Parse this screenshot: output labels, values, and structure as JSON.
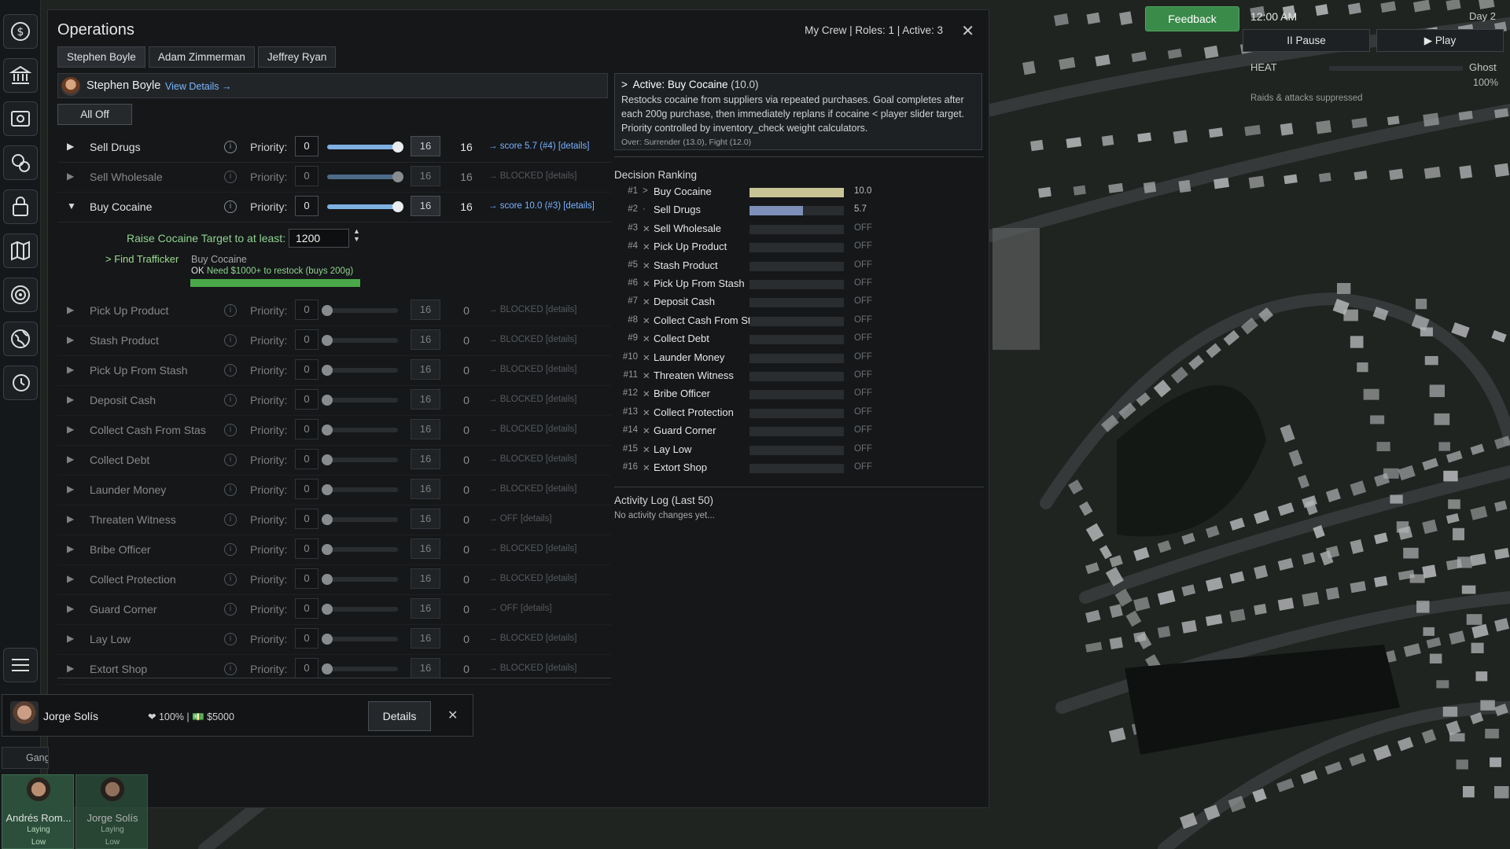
{
  "panel": {
    "title": "Operations",
    "crew_summary": "My Crew | Roles: 1 | Active: 3",
    "close_glyph": "✕",
    "tabs": [
      "Stephen Boyle",
      "Adam Zimmerman",
      "Jeffrey Ryan"
    ],
    "active_tab": 0,
    "member_name": "Stephen Boyle",
    "view_details": "View Details →",
    "all_off": "All Off"
  },
  "tasks": [
    {
      "name": "Sell Drugs",
      "expanded": false,
      "priority_label": "Priority:",
      "min": "0",
      "max": "16",
      "value": "16",
      "score": "→ score 5.7 (#4) [details]",
      "enabled": true,
      "level": 1.0
    },
    {
      "name": "Sell Wholesale",
      "expanded": false,
      "priority_label": "Priority:",
      "min": "0",
      "max": "16",
      "value": "16",
      "score": "→ BLOCKED [details]",
      "enabled": false,
      "level": 1.0
    },
    {
      "name": "Buy Cocaine",
      "expanded": true,
      "priority_label": "Priority:",
      "min": "0",
      "max": "16",
      "value": "16",
      "score": "→ score 10.0 (#3) [details]",
      "enabled": true,
      "level": 1.0
    },
    {
      "name": "Pick Up Product",
      "expanded": false,
      "priority_label": "Priority:",
      "min": "0",
      "max": "16",
      "value": "0",
      "score": "→ BLOCKED [details]",
      "enabled": false,
      "level": 0
    },
    {
      "name": "Stash Product",
      "expanded": false,
      "priority_label": "Priority:",
      "min": "0",
      "max": "16",
      "value": "0",
      "score": "→ BLOCKED [details]",
      "enabled": false,
      "level": 0
    },
    {
      "name": "Pick Up From Stash",
      "expanded": false,
      "priority_label": "Priority:",
      "min": "0",
      "max": "16",
      "value": "0",
      "score": "→ BLOCKED [details]",
      "enabled": false,
      "level": 0
    },
    {
      "name": "Deposit Cash",
      "expanded": false,
      "priority_label": "Priority:",
      "min": "0",
      "max": "16",
      "value": "0",
      "score": "→ BLOCKED [details]",
      "enabled": false,
      "level": 0
    },
    {
      "name": "Collect Cash From Stas",
      "expanded": false,
      "priority_label": "Priority:",
      "min": "0",
      "max": "16",
      "value": "0",
      "score": "→ BLOCKED [details]",
      "enabled": false,
      "level": 0
    },
    {
      "name": "Collect Debt",
      "expanded": false,
      "priority_label": "Priority:",
      "min": "0",
      "max": "16",
      "value": "0",
      "score": "→ BLOCKED [details]",
      "enabled": false,
      "level": 0
    },
    {
      "name": "Launder Money",
      "expanded": false,
      "priority_label": "Priority:",
      "min": "0",
      "max": "16",
      "value": "0",
      "score": "→ BLOCKED [details]",
      "enabled": false,
      "level": 0
    },
    {
      "name": "Threaten Witness",
      "expanded": false,
      "priority_label": "Priority:",
      "min": "0",
      "max": "16",
      "value": "0",
      "score": "→ OFF [details]",
      "enabled": false,
      "level": 0
    },
    {
      "name": "Bribe Officer",
      "expanded": false,
      "priority_label": "Priority:",
      "min": "0",
      "max": "16",
      "value": "0",
      "score": "→ BLOCKED [details]",
      "enabled": false,
      "level": 0
    },
    {
      "name": "Collect Protection",
      "expanded": false,
      "priority_label": "Priority:",
      "min": "0",
      "max": "16",
      "value": "0",
      "score": "→ BLOCKED [details]",
      "enabled": false,
      "level": 0
    },
    {
      "name": "Guard Corner",
      "expanded": false,
      "priority_label": "Priority:",
      "min": "0",
      "max": "16",
      "value": "0",
      "score": "→ OFF [details]",
      "enabled": false,
      "level": 0
    },
    {
      "name": "Lay Low",
      "expanded": false,
      "priority_label": "Priority:",
      "min": "0",
      "max": "16",
      "value": "0",
      "score": "→ BLOCKED [details]",
      "enabled": false,
      "level": 0
    },
    {
      "name": "Extort Shop",
      "expanded": false,
      "priority_label": "Priority:",
      "min": "0",
      "max": "16",
      "value": "0",
      "score": "→ BLOCKED [details]",
      "enabled": false,
      "level": 0
    }
  ],
  "buy_cocaine": {
    "raise_label": "Raise Cocaine Target to at least:",
    "raise_value": "1200",
    "find_trafficker": "> Find Trafficker",
    "sub_title": "Buy Cocaine",
    "ok": "OK",
    "need": "Need $1000+ to restock (buys 200g)",
    "progress": 1.0
  },
  "active": {
    "title": "Active: Buy Cocaine",
    "score": "(10.0)",
    "marker": ">",
    "description": "Restocks cocaine from suppliers via repeated purchases. Goal completes after each 200g purchase, then immediately replans if cocaine < player slider target. Priority controlled by inventory_check weight calculators.",
    "over": "Over: Surrender (13.0), Fight (12.0)"
  },
  "ranking": {
    "title": "Decision Ranking",
    "rows": [
      {
        "rank": "#1",
        "mark": ">",
        "name": "Buy Cocaine",
        "value": "10.0",
        "score": 10.0,
        "color": "#c9c495"
      },
      {
        "rank": "#2",
        "mark": "·",
        "name": "Sell Drugs",
        "value": "5.7",
        "score": 5.7,
        "color": "#7d8fb8"
      },
      {
        "rank": "#3",
        "mark": "✕",
        "name": "Sell Wholesale",
        "value": "OFF",
        "score": 0
      },
      {
        "rank": "#4",
        "mark": "✕",
        "name": "Pick Up Product",
        "value": "OFF",
        "score": 0
      },
      {
        "rank": "#5",
        "mark": "✕",
        "name": "Stash Product",
        "value": "OFF",
        "score": 0
      },
      {
        "rank": "#6",
        "mark": "✕",
        "name": "Pick Up From Stash",
        "value": "OFF",
        "score": 0
      },
      {
        "rank": "#7",
        "mark": "✕",
        "name": "Deposit Cash",
        "value": "OFF",
        "score": 0
      },
      {
        "rank": "#8",
        "mark": "✕",
        "name": "Collect Cash From St",
        "value": "OFF",
        "score": 0
      },
      {
        "rank": "#9",
        "mark": "✕",
        "name": "Collect Debt",
        "value": "OFF",
        "score": 0
      },
      {
        "rank": "#10",
        "mark": "✕",
        "name": "Launder Money",
        "value": "OFF",
        "score": 0
      },
      {
        "rank": "#11",
        "mark": "✕",
        "name": "Threaten Witness",
        "value": "OFF",
        "score": 0
      },
      {
        "rank": "#12",
        "mark": "✕",
        "name": "Bribe Officer",
        "value": "OFF",
        "score": 0
      },
      {
        "rank": "#13",
        "mark": "✕",
        "name": "Collect Protection",
        "value": "OFF",
        "score": 0
      },
      {
        "rank": "#14",
        "mark": "✕",
        "name": "Guard Corner",
        "value": "OFF",
        "score": 0
      },
      {
        "rank": "#15",
        "mark": "✕",
        "name": "Lay Low",
        "value": "OFF",
        "score": 0
      },
      {
        "rank": "#16",
        "mark": "✕",
        "name": "Extort Shop",
        "value": "OFF",
        "score": 0
      }
    ]
  },
  "activity_log": {
    "title": "Activity Log (Last 50)",
    "empty": "No activity changes yet..."
  },
  "member_card": {
    "name": "Jorge Solís",
    "stats": "❤ 100% | 💵 $5000",
    "details": "Details",
    "close": "✕"
  },
  "gang_tab": "Gang",
  "crew_cards": [
    {
      "name": "Andrés Rom...",
      "status": "Laying",
      "level": "Low"
    },
    {
      "name": "Jorge Solís",
      "status": "Laying",
      "level": "Low"
    }
  ],
  "hud": {
    "feedback": "Feedback",
    "time": "12:00 AM",
    "day": "Day 2",
    "pause": "II Pause",
    "play": "▶ Play",
    "heat_label": "HEAT",
    "heat_level": "Ghost",
    "heat_pct": "100%",
    "raids_note": "Raids & attacks suppressed"
  },
  "sidebar_icons": [
    "dollar-icon",
    "bank-icon",
    "surveillance-icon",
    "drug-timer-icon",
    "locked-bag-icon",
    "map-icon",
    "target-icon",
    "globe-icon",
    "history-icon",
    "menu-icon"
  ],
  "colors": {
    "accent": "#7eb0e2",
    "ok_green": "#4aa84a",
    "feedback_green": "#3a8a4a"
  }
}
